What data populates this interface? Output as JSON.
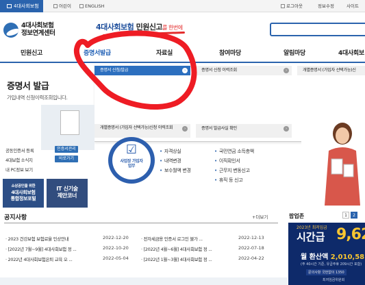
{
  "topbar": {
    "home": "4대사회보험",
    "links": [
      "어린이",
      "ENGLISH"
    ],
    "right": [
      "로그아웃",
      "정보수정",
      "사이트"
    ]
  },
  "header": {
    "logo_line1": "4대사회보험",
    "logo_line2": "정보연계센터",
    "slogan_main": "4대사회보험",
    "slogan_bold": "민원신고",
    "slogan_small": "를 한번에"
  },
  "gnb": [
    "민원신고",
    "증명서발급",
    "자료실",
    "참여마당",
    "알림마당",
    "4대사회보"
  ],
  "dropdown": {
    "row1": [
      "증명서 신청/발급",
      "증명서 신청 이력조회",
      "개별증명서 (가입자 선택가능)신"
    ],
    "row2": [
      "개별증명서 (가입자 선택가능)신청 이력조회",
      "증명서 발급사실 확인"
    ]
  },
  "left": {
    "title": "증명서 발급",
    "subtitle": "가입내역 신청이력조회입니다.",
    "quick": [
      "공동인증서 등록",
      "4대보험 소식지",
      "내 PC정보 보기"
    ],
    "quick_btn1": "인증서관리",
    "quick_btn2": "바로가기",
    "box1_l1": "소상공인을 위한",
    "box1_l2": "4대사회보험",
    "box1_l3": "통합정보포털",
    "box2_l1": "IT 신기술",
    "box2_l2": "제안코너"
  },
  "center": {
    "circle_l1": "사업장 가입자",
    "circle_l2": "업무",
    "col1": [
      "자격상실",
      "내역변경",
      "보수월액 변경"
    ],
    "col2": [
      "국민연금 소득총액",
      "이직확인서",
      "근무지 변동신고",
      "휴직 등 신고"
    ]
  },
  "notice": {
    "title": "공지사항",
    "more": "+더보기",
    "items": [
      {
        "text": "2023 건강보험 보험료율 인상안내",
        "date": "2022-12-20"
      },
      {
        "text": "[2022년 7월~9월] 4대사회보험 정 ...",
        "date": "2022-10-20"
      },
      {
        "text": "2022년 4대사회보험은퇴 교육 오 ...",
        "date": "2022-05-04"
      },
      {
        "text": "전자세금용 인증서 로그인 불가 ...",
        "date": "2022-12-13"
      },
      {
        "text": "[2022년 4월~6월] 4대사회보험 정 ...",
        "date": "2022-07-18"
      },
      {
        "text": "[2022년 1월~3월] 4대사회보험 정 ...",
        "date": "2022-04-22"
      }
    ]
  },
  "popup": {
    "title": "팝업존",
    "pages": [
      "1",
      "2"
    ],
    "banner_year": "2023년 최저임금",
    "banner_kind": "시간급",
    "banner_value": "9,62",
    "banner_month_label": "월 환산액",
    "banner_month_value": "2,010,58",
    "banner_sub": "(주 40시간 기준, 유급주휴 209시간 포함)",
    "banner_contact": "문의사항 국번없이 1350",
    "banner_org": "최저임금위원회"
  },
  "colors": {
    "primary": "#2a63ad",
    "selected": "#2c6fbf",
    "navy": "#2c4e86"
  }
}
